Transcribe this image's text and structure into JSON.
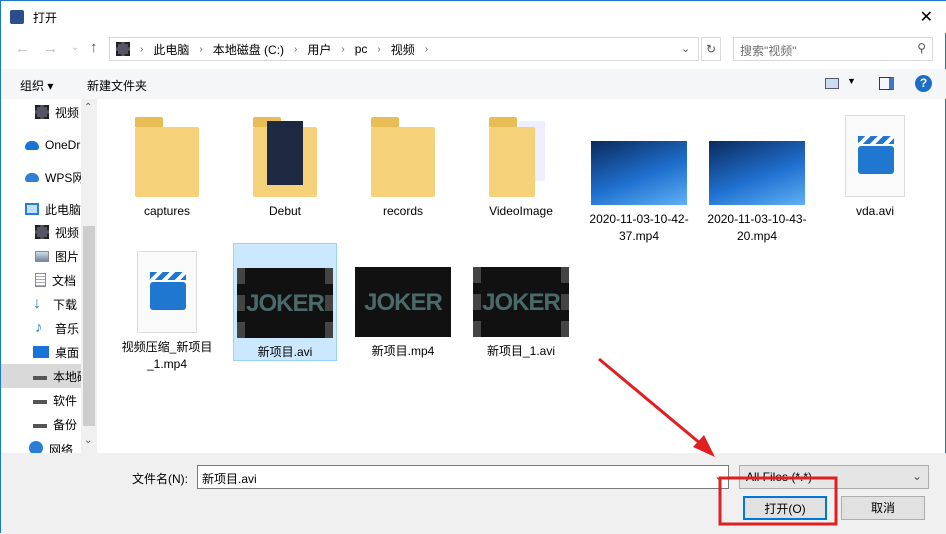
{
  "window": {
    "title": "打开",
    "close": "✕"
  },
  "address": {
    "crumbs": [
      "此电脑",
      "本地磁盘 (C:)",
      "用户",
      "pc",
      "视频"
    ],
    "refresh": "↻"
  },
  "search": {
    "placeholder": "搜索\"视频\""
  },
  "toolbar": {
    "organize": "组织 ▾",
    "new_folder": "新建文件夹",
    "help": "?"
  },
  "sidebar": {
    "items": [
      {
        "label": "视频"
      },
      {
        "label": "OneDrive"
      },
      {
        "label": "WPS网盘"
      },
      {
        "label": "此电脑"
      },
      {
        "label": "视频"
      },
      {
        "label": "图片"
      },
      {
        "label": "文档"
      },
      {
        "label": "下载"
      },
      {
        "label": "音乐"
      },
      {
        "label": "桌面"
      },
      {
        "label": "本地磁盘"
      },
      {
        "label": "软件"
      },
      {
        "label": "备份"
      },
      {
        "label": "网络"
      }
    ]
  },
  "files": [
    {
      "name": "captures",
      "type": "folder"
    },
    {
      "name": "Debut",
      "type": "folder"
    },
    {
      "name": "records",
      "type": "folder"
    },
    {
      "name": "VideoImage",
      "type": "folder"
    },
    {
      "name": "2020-11-03-10-42-37.mp4",
      "type": "video"
    },
    {
      "name": "2020-11-03-10-43-20.mp4",
      "type": "video"
    },
    {
      "name": "vda.avi",
      "type": "doc"
    },
    {
      "name": "视频压缩_新项目_1.mp4",
      "type": "doc"
    },
    {
      "name": "新项目.avi",
      "type": "joker",
      "selected": true
    },
    {
      "name": "新项目.mp4",
      "type": "joker"
    },
    {
      "name": "新项目_1.avi",
      "type": "joker"
    }
  ],
  "joker_text": "JOKER",
  "bottom": {
    "filename_label": "文件名(N):",
    "filename_value": "新项目.avi",
    "filetype": "All Files (*.*)",
    "open": "打开(O)",
    "cancel": "取消"
  },
  "colors": {
    "accent": "#1979ca",
    "annotation": "#e02020"
  }
}
